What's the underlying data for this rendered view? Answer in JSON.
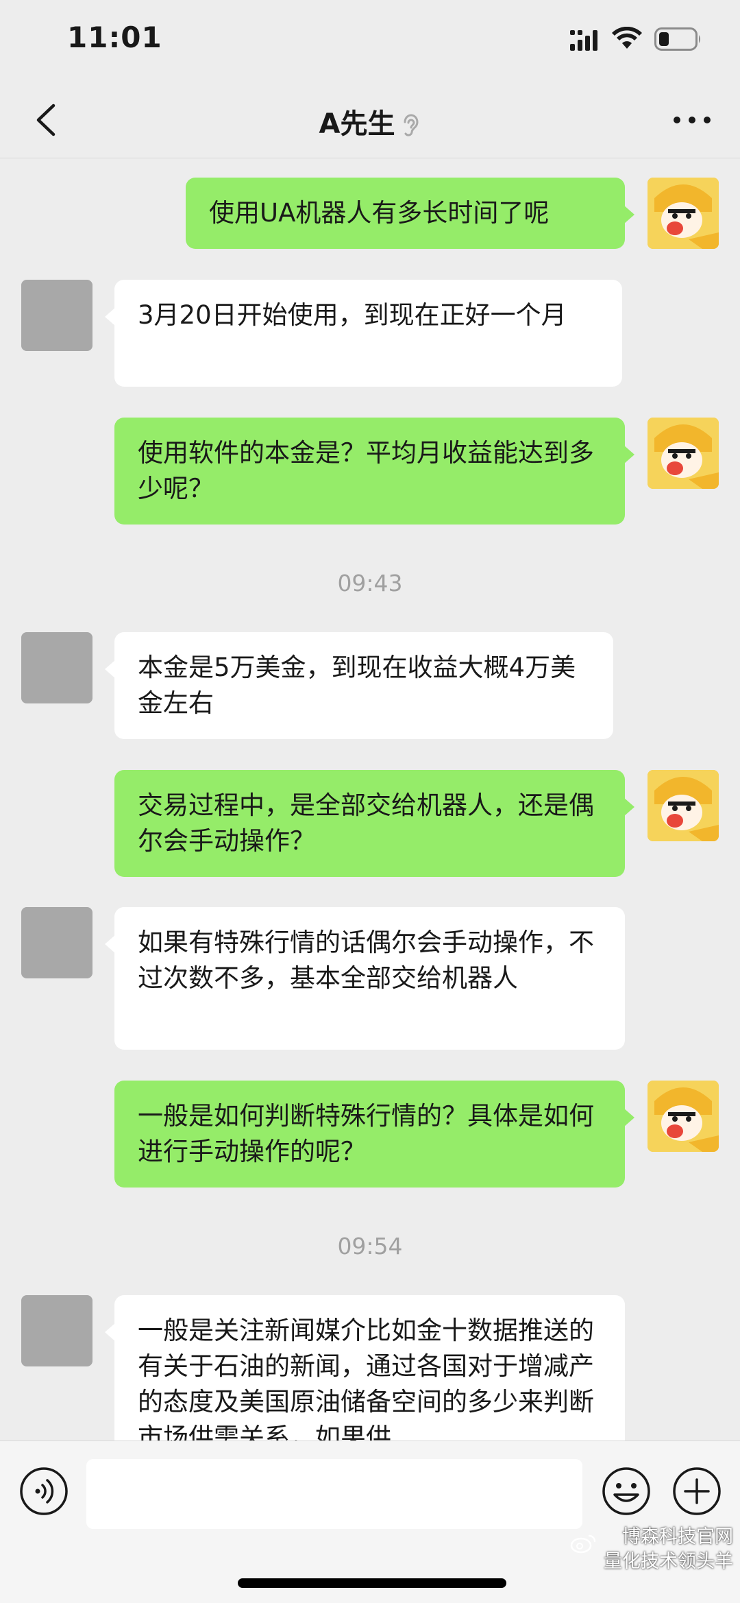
{
  "status_bar": {
    "time": "11:01"
  },
  "nav": {
    "title": "A先生"
  },
  "messages": [
    {
      "type": "out",
      "text": "使用UA机器人有多长时间了呢"
    },
    {
      "type": "in",
      "text": "3月20日开始使用，到现在正好一个月"
    },
    {
      "type": "out",
      "text": "使用软件的本金是？平均月收益能达到多少呢？"
    },
    {
      "type": "time",
      "text": "09:43"
    },
    {
      "type": "in",
      "text": "本金是5万美金，到现在收益大概4万美金左右"
    },
    {
      "type": "out",
      "text": "交易过程中，是全部交给机器人，还是偶尔会手动操作？"
    },
    {
      "type": "in",
      "text": "如果有特殊行情的话偶尔会手动操作，不过次数不多，基本全部交给机器人"
    },
    {
      "type": "out",
      "text": "一般是如何判断特殊行情的？具体是如何进行手动操作的呢？"
    },
    {
      "type": "time",
      "text": "09:54"
    },
    {
      "type": "in",
      "text": "一般是关注新闻媒介比如金十数据推送的有关于石油的新闻，通过各国对于增减产的态度及美国原油储备空间的多少来判断市场供需关系，如果供"
    }
  ],
  "input": {
    "value": ""
  },
  "watermark": {
    "line1": "博森科技官网",
    "line2": "量化技术领头羊"
  }
}
